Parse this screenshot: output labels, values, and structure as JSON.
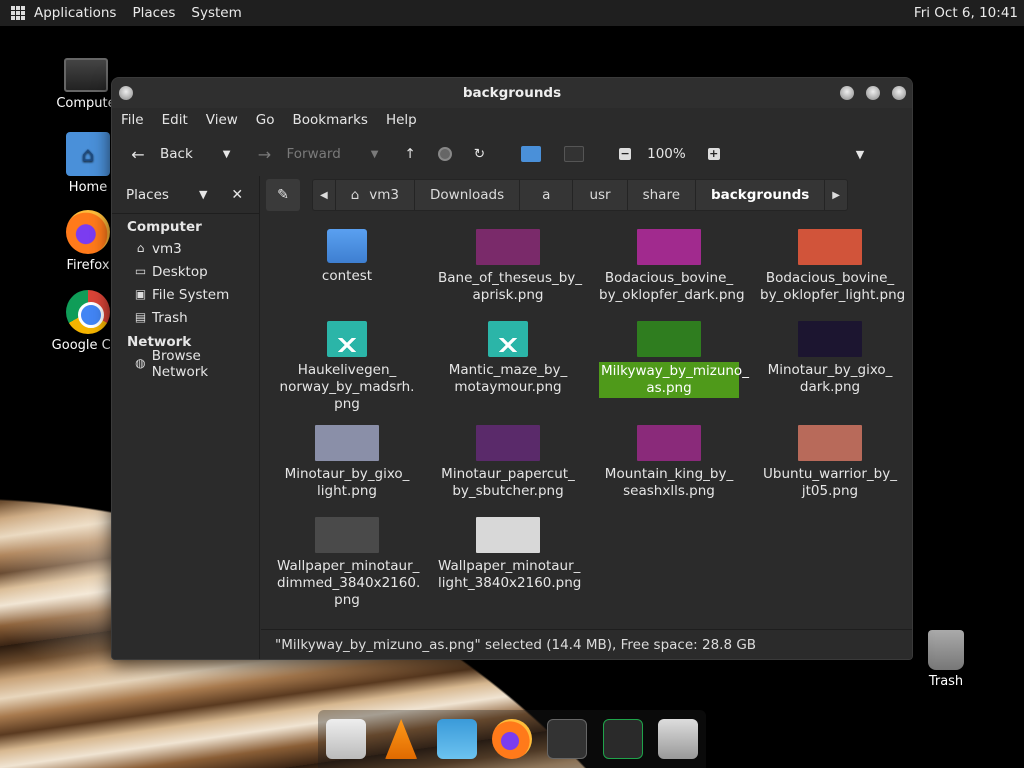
{
  "top_panel": {
    "menus": [
      "Applications",
      "Places",
      "System"
    ],
    "clock": "Fri Oct  6, 10:41"
  },
  "desktop": {
    "icons": [
      {
        "label": "Compute",
        "icon": "computer-icon"
      },
      {
        "label": "Home",
        "icon": "home-folder-icon"
      },
      {
        "label": "Firefox",
        "icon": "firefox-icon"
      },
      {
        "label": "Google Chr",
        "icon": "chrome-icon"
      }
    ],
    "trash_label": "Trash"
  },
  "window": {
    "title": "backgrounds",
    "menubar": [
      "File",
      "Edit",
      "View",
      "Go",
      "Bookmarks",
      "Help"
    ],
    "toolbar": {
      "back_label": "Back",
      "forward_label": "Forward",
      "zoom_level": "100%"
    },
    "sidebar": {
      "header": "Places",
      "sections": [
        {
          "title": "Computer",
          "items": [
            {
              "label": "vm3",
              "icon": "home-icon"
            },
            {
              "label": "Desktop",
              "icon": "desktop-icon"
            },
            {
              "label": "File System",
              "icon": "drive-icon"
            },
            {
              "label": "Trash",
              "icon": "trash-icon"
            }
          ]
        },
        {
          "title": "Network",
          "items": [
            {
              "label": "Browse Network",
              "icon": "network-icon"
            }
          ]
        }
      ]
    },
    "pathbar": [
      "vm3",
      "Downloads",
      "a",
      "usr",
      "share",
      "backgrounds"
    ],
    "files": [
      {
        "name": "contest",
        "kind": "folder"
      },
      {
        "name": "Bane_of_theseus_by_\naprisk.png",
        "kind": "image",
        "color": "#7a2a6a"
      },
      {
        "name": "Bodacious_bovine_\nby_oklopfer_dark.png",
        "kind": "image",
        "color": "#a12a8e"
      },
      {
        "name": "Bodacious_bovine_\nby_oklopfer_light.png",
        "kind": "image",
        "color": "#d1543a"
      },
      {
        "name": "Haukelivegen_\nnorway_by_madsrh.\npng",
        "kind": "placeholder"
      },
      {
        "name": "Mantic_maze_by_\nmotaymour.png",
        "kind": "placeholder"
      },
      {
        "name": "Milkyway_by_mizuno_\nas.png",
        "kind": "image",
        "color": "#2f7d1f",
        "selected": true
      },
      {
        "name": "Minotaur_by_gixo_\ndark.png",
        "kind": "image",
        "color": "#1c1530"
      },
      {
        "name": "Minotaur_by_gixo_\nlight.png",
        "kind": "image",
        "color": "#8a8fa8"
      },
      {
        "name": "Minotaur_papercut_\nby_sbutcher.png",
        "kind": "image",
        "color": "#5a2a6a"
      },
      {
        "name": "Mountain_king_by_\nseashxlls.png",
        "kind": "image",
        "color": "#8a2a7a"
      },
      {
        "name": "Ubuntu_warrior_by_\njt05.png",
        "kind": "image",
        "color": "#b86a5a"
      },
      {
        "name": "Wallpaper_minotaur_\ndimmed_3840x2160.\npng",
        "kind": "image",
        "color": "#4a4a4a"
      },
      {
        "name": "Wallpaper_minotaur_\nlight_3840x2160.png",
        "kind": "image",
        "color": "#d8d8d8"
      }
    ],
    "status": "\"Milkyway_by_mizuno_as.png\" selected (14.4 MB), Free space: 28.8 GB"
  },
  "dock": [
    "text-editor-icon",
    "vlc-icon",
    "image-viewer-icon",
    "firefox-icon",
    "terminal-icon",
    "system-monitor-icon",
    "file-manager-icon"
  ],
  "colors": {
    "selection": "#4f9a1a",
    "window_bg": "#2b2b2b",
    "panel_bg": "#1f1f1f"
  }
}
